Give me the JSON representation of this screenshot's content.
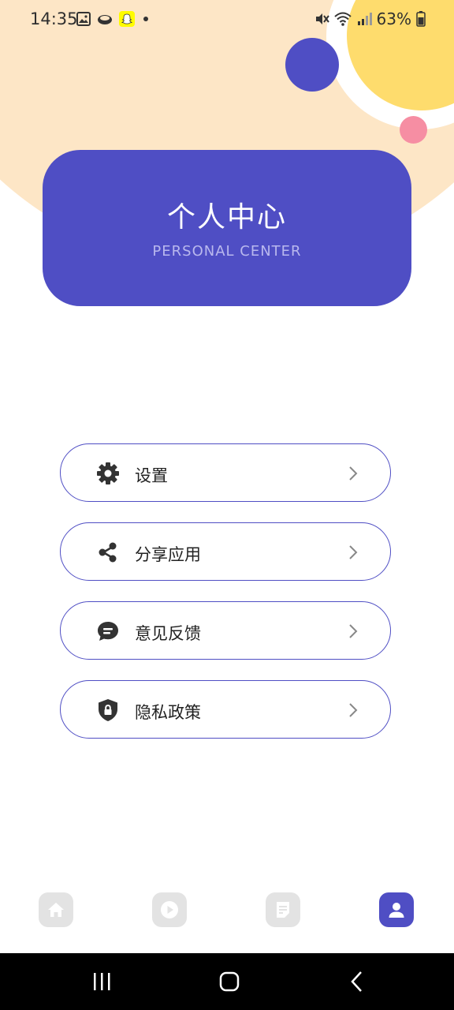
{
  "status_bar": {
    "time": "14:35",
    "battery": "63%"
  },
  "header": {
    "title": "个人中心",
    "subtitle": "PERSONAL CENTER"
  },
  "menu": {
    "items": [
      {
        "label": "设置",
        "icon": "gear-icon"
      },
      {
        "label": "分享应用",
        "icon": "share-icon"
      },
      {
        "label": "意见反馈",
        "icon": "chat-bubble-icon"
      },
      {
        "label": "隐私政策",
        "icon": "shield-lock-icon"
      }
    ]
  },
  "tabs": [
    {
      "icon": "home-icon",
      "active": false
    },
    {
      "icon": "play-icon",
      "active": false
    },
    {
      "icon": "document-icon",
      "active": false
    },
    {
      "icon": "user-icon",
      "active": true
    }
  ],
  "colors": {
    "accent": "#4f4ec4",
    "peach": "#fde6c6",
    "yellow": "#fedc6d",
    "pink": "#f68ea3",
    "tab_inactive": "#e3e3e3"
  }
}
